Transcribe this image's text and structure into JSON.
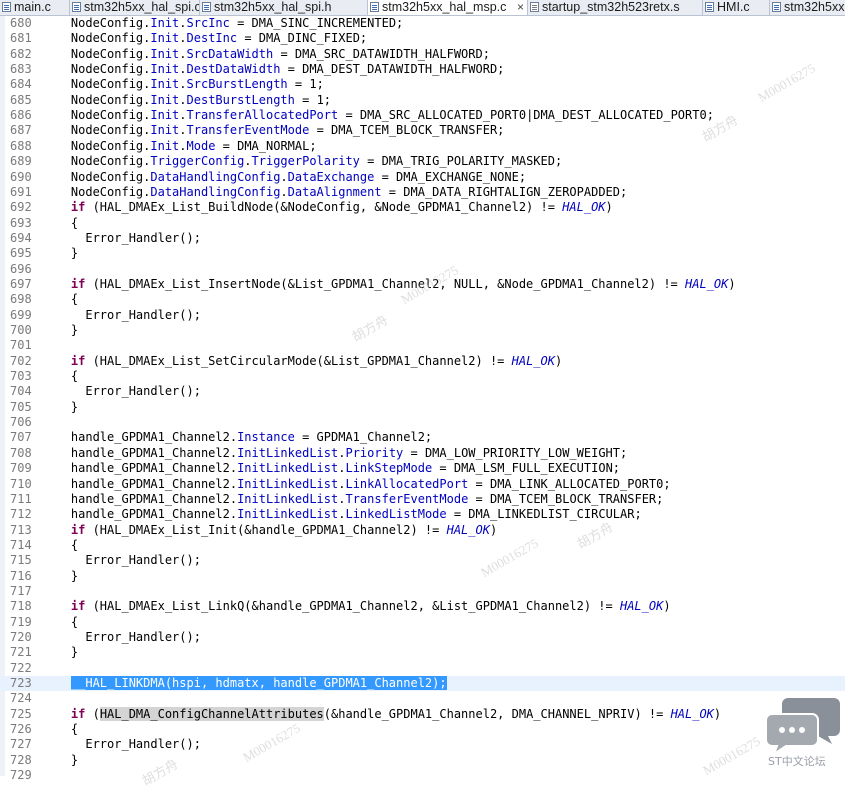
{
  "tabs": [
    {
      "label": "main.c",
      "icon": "c-source-file-icon",
      "active": false
    },
    {
      "label": "stm32h5xx_hal_spi.c",
      "icon": "c-source-file-icon",
      "active": false
    },
    {
      "label": "stm32h5xx_hal_spi.h",
      "icon": "c-header-file-icon",
      "active": false
    },
    {
      "label": "stm32h5xx_hal_msp.c",
      "icon": "c-source-file-icon",
      "active": true,
      "close": "×"
    },
    {
      "label": "startup_stm32h523retx.s",
      "icon": "assembly-file-icon",
      "active": false
    },
    {
      "label": "HMI.c",
      "icon": "c-source-file-icon",
      "active": false
    },
    {
      "label": "stm32h5xx",
      "icon": "c-source-file-icon",
      "active": false
    }
  ],
  "editor": {
    "current_line": "723",
    "lines": [
      {
        "n": "680",
        "t": "    NodeConfig.Init.SrcInc = DMA_SINC_INCREMENTED;"
      },
      {
        "n": "681",
        "t": "    NodeConfig.Init.DestInc = DMA_DINC_FIXED;"
      },
      {
        "n": "682",
        "t": "    NodeConfig.Init.SrcDataWidth = DMA_SRC_DATAWIDTH_HALFWORD;"
      },
      {
        "n": "683",
        "t": "    NodeConfig.Init.DestDataWidth = DMA_DEST_DATAWIDTH_HALFWORD;"
      },
      {
        "n": "684",
        "t": "    NodeConfig.Init.SrcBurstLength = 1;"
      },
      {
        "n": "685",
        "t": "    NodeConfig.Init.DestBurstLength = 1;"
      },
      {
        "n": "686",
        "t": "    NodeConfig.Init.TransferAllocatedPort = DMA_SRC_ALLOCATED_PORT0|DMA_DEST_ALLOCATED_PORT0;"
      },
      {
        "n": "687",
        "t": "    NodeConfig.Init.TransferEventMode = DMA_TCEM_BLOCK_TRANSFER;"
      },
      {
        "n": "688",
        "t": "    NodeConfig.Init.Mode = DMA_NORMAL;"
      },
      {
        "n": "689",
        "t": "    NodeConfig.TriggerConfig.TriggerPolarity = DMA_TRIG_POLARITY_MASKED;"
      },
      {
        "n": "690",
        "t": "    NodeConfig.DataHandlingConfig.DataExchange = DMA_EXCHANGE_NONE;"
      },
      {
        "n": "691",
        "t": "    NodeConfig.DataHandlingConfig.DataAlignment = DMA_DATA_RIGHTALIGN_ZEROPADDED;"
      },
      {
        "n": "692",
        "t": "    if (HAL_DMAEx_List_BuildNode(&NodeConfig, &Node_GPDMA1_Channel2) != HAL_OK)"
      },
      {
        "n": "693",
        "t": "    {"
      },
      {
        "n": "694",
        "t": "      Error_Handler();"
      },
      {
        "n": "695",
        "t": "    }"
      },
      {
        "n": "696",
        "t": ""
      },
      {
        "n": "697",
        "t": "    if (HAL_DMAEx_List_InsertNode(&List_GPDMA1_Channel2, NULL, &Node_GPDMA1_Channel2) != HAL_OK)"
      },
      {
        "n": "698",
        "t": "    {"
      },
      {
        "n": "699",
        "t": "      Error_Handler();"
      },
      {
        "n": "700",
        "t": "    }"
      },
      {
        "n": "701",
        "t": ""
      },
      {
        "n": "702",
        "t": "    if (HAL_DMAEx_List_SetCircularMode(&List_GPDMA1_Channel2) != HAL_OK)"
      },
      {
        "n": "703",
        "t": "    {"
      },
      {
        "n": "704",
        "t": "      Error_Handler();"
      },
      {
        "n": "705",
        "t": "    }"
      },
      {
        "n": "706",
        "t": ""
      },
      {
        "n": "707",
        "t": "    handle_GPDMA1_Channel2.Instance = GPDMA1_Channel2;"
      },
      {
        "n": "708",
        "t": "    handle_GPDMA1_Channel2.InitLinkedList.Priority = DMA_LOW_PRIORITY_LOW_WEIGHT;"
      },
      {
        "n": "709",
        "t": "    handle_GPDMA1_Channel2.InitLinkedList.LinkStepMode = DMA_LSM_FULL_EXECUTION;"
      },
      {
        "n": "710",
        "t": "    handle_GPDMA1_Channel2.InitLinkedList.LinkAllocatedPort = DMA_LINK_ALLOCATED_PORT0;"
      },
      {
        "n": "711",
        "t": "    handle_GPDMA1_Channel2.InitLinkedList.TransferEventMode = DMA_TCEM_BLOCK_TRANSFER;"
      },
      {
        "n": "712",
        "t": "    handle_GPDMA1_Channel2.InitLinkedList.LinkedListMode = DMA_LINKEDLIST_CIRCULAR;"
      },
      {
        "n": "713",
        "t": "    if (HAL_DMAEx_List_Init(&handle_GPDMA1_Channel2) != HAL_OK)"
      },
      {
        "n": "714",
        "t": "    {"
      },
      {
        "n": "715",
        "t": "      Error_Handler();"
      },
      {
        "n": "716",
        "t": "    }"
      },
      {
        "n": "717",
        "t": ""
      },
      {
        "n": "718",
        "t": "    if (HAL_DMAEx_List_LinkQ(&handle_GPDMA1_Channel2, &List_GPDMA1_Channel2) != HAL_OK)"
      },
      {
        "n": "719",
        "t": "    {"
      },
      {
        "n": "720",
        "t": "      Error_Handler();"
      },
      {
        "n": "721",
        "t": "    }"
      },
      {
        "n": "722",
        "t": ""
      },
      {
        "n": "723",
        "t": "    __HAL_LINKDMA(hspi, hdmatx, handle_GPDMA1_Channel2);"
      },
      {
        "n": "724",
        "t": ""
      },
      {
        "n": "725",
        "t": "    if (HAL_DMA_ConfigChannelAttributes(&handle_GPDMA1_Channel2, DMA_CHANNEL_NPRIV) != HAL_OK)"
      },
      {
        "n": "726",
        "t": "    {"
      },
      {
        "n": "727",
        "t": "      Error_Handler();"
      },
      {
        "n": "728",
        "t": "    }"
      },
      {
        "n": "729",
        "t": ""
      }
    ]
  },
  "watermark": {
    "text": "M00016275",
    "name": "胡方舟"
  },
  "logo": {
    "text": "ST中文论坛",
    "icon": "chat-bubbles-icon",
    "color": "#8a9099"
  },
  "colors": {
    "field": "#0000c0",
    "keyword": "#7f0055",
    "macro": "#0000c0",
    "selection": "#3399ff",
    "current_line": "#e8f2fe",
    "line_number": "#7a7a7a"
  }
}
